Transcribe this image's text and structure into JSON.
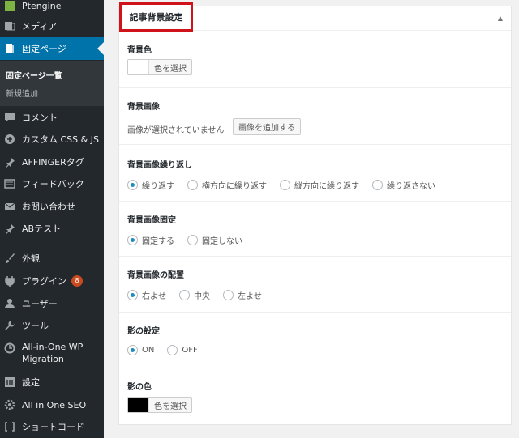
{
  "sidebar": {
    "items": [
      {
        "label": "Ptengine",
        "icon": "ptengine-icon"
      },
      {
        "label": "メディア",
        "icon": "media-icon"
      },
      {
        "label": "固定ページ",
        "icon": "pages-icon"
      },
      {
        "label": "コメント",
        "icon": "comment-icon"
      },
      {
        "label": "カスタム CSS & JS",
        "icon": "plus-circle-icon"
      },
      {
        "label": "AFFINGERタグ",
        "icon": "pin-icon"
      },
      {
        "label": "フィードバック",
        "icon": "feedback-icon"
      },
      {
        "label": "お問い合わせ",
        "icon": "mail-icon"
      },
      {
        "label": "ABテスト",
        "icon": "pin-icon"
      },
      {
        "label": "外観",
        "icon": "paintbrush-icon"
      },
      {
        "label": "プラグイン",
        "icon": "plugin-icon",
        "badge": "8"
      },
      {
        "label": "ユーザー",
        "icon": "user-icon"
      },
      {
        "label": "ツール",
        "icon": "wrench-icon"
      },
      {
        "label": "All-in-One WP",
        "label2": "Migration",
        "icon": "migration-icon"
      },
      {
        "label": "設定",
        "icon": "settings-icon"
      },
      {
        "label": "All in One SEO",
        "icon": "gear-icon"
      },
      {
        "label": "ショートコード",
        "icon": "shortcode-icon"
      }
    ],
    "submenu": [
      "固定ページ一覧",
      "新規追加"
    ]
  },
  "panel": {
    "title": "記事背景設定",
    "toggle": "▲",
    "bg_color": {
      "label": "背景色",
      "button": "色を選択",
      "swatch": "#ffffff"
    },
    "bg_image": {
      "label": "背景画像",
      "status": "画像が選択されていません",
      "button": "画像を追加する"
    },
    "bg_repeat": {
      "label": "背景画像繰り返し",
      "options": [
        "繰り返す",
        "横方向に繰り返す",
        "縦方向に繰り返す",
        "繰り返さない"
      ],
      "selected": 0
    },
    "bg_fixed": {
      "label": "背景画像固定",
      "options": [
        "固定する",
        "固定しない"
      ],
      "selected": 0
    },
    "bg_position": {
      "label": "背景画像の配置",
      "options": [
        "右よせ",
        "中央",
        "左よせ"
      ],
      "selected": 0
    },
    "shadow": {
      "label": "影の設定",
      "options": [
        "ON",
        "OFF"
      ],
      "selected": 0
    },
    "shadow_color": {
      "label": "影の色",
      "button": "色を選択",
      "swatch": "#000000"
    }
  }
}
